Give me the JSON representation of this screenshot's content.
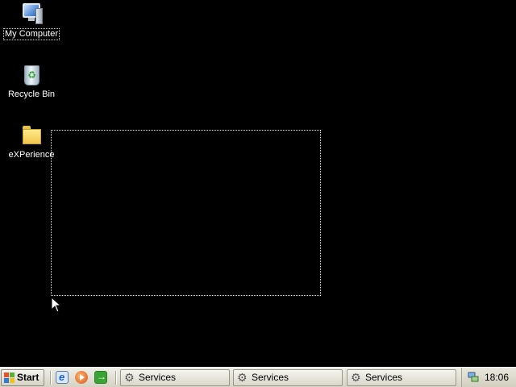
{
  "desktop": {
    "icons": [
      {
        "label": "My Computer",
        "icon": "my-computer-icon",
        "selected": true
      },
      {
        "label": "Recycle Bin",
        "icon": "recycle-bin-icon",
        "selected": false
      },
      {
        "label": "eXPerience",
        "icon": "folder-icon",
        "selected": false
      }
    ]
  },
  "taskbar": {
    "start_label": "Start",
    "quick_launch": [
      "internet-explorer-icon",
      "media-player-icon",
      "show-desktop-icon"
    ],
    "tasks": [
      {
        "label": "Services",
        "icon": "services-gear-icon"
      },
      {
        "label": "Services",
        "icon": "services-gear-icon"
      },
      {
        "label": "Services",
        "icon": "services-gear-icon"
      }
    ],
    "tray": {
      "icon": "network-icon",
      "clock": "18:06"
    }
  },
  "colors": {
    "desktop_bg": "#000000",
    "taskbar_bg": "#e3e1d5"
  }
}
